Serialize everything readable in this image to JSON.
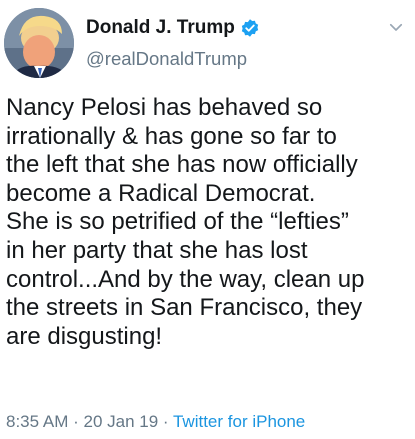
{
  "tweet": {
    "display_name": "Donald J. Trump",
    "handle": "@realDonaldTrump",
    "verified": true,
    "text": "Nancy Pelosi has behaved so\nirrationally & has gone so far to\nthe left that she has now officially\nbecome a Radical Democrat.\nShe is so petrified of the “lefties”\nin her party that she has lost\ncontrol...And by the way, clean up\nthe streets in San Francisco, they\nare disgusting!",
    "time": "8:35 AM",
    "date": "20 Jan 19",
    "separator": " · ",
    "source": "Twitter for iPhone"
  },
  "icons": {
    "verified": "verified-badge-icon",
    "caret": "chevron-down-icon"
  },
  "colors": {
    "text": "#14171a",
    "secondary": "#657786",
    "link": "#1b95e0",
    "verified": "#1da1f2"
  }
}
